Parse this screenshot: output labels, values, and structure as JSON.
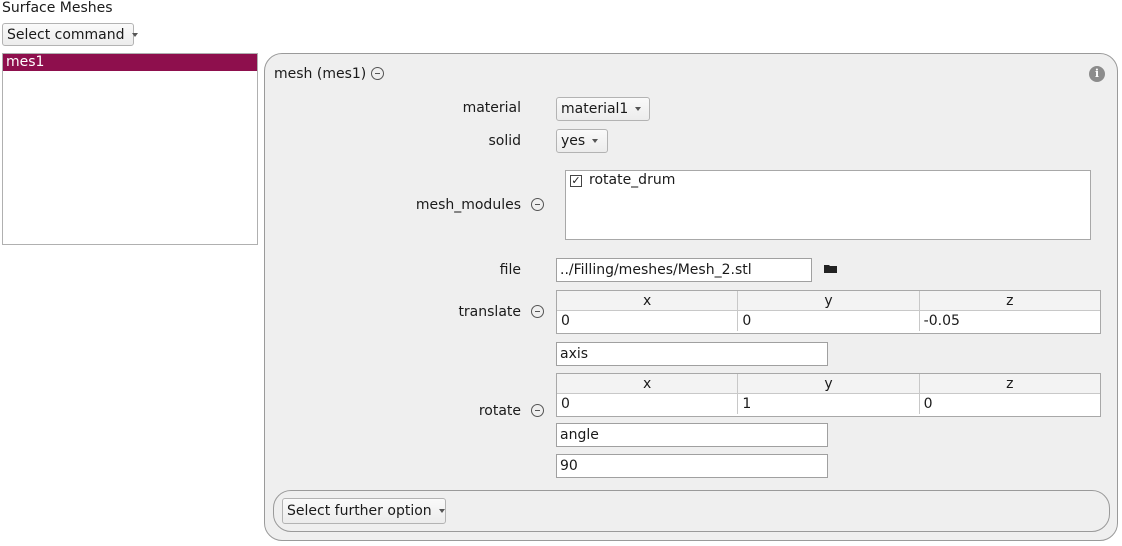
{
  "header": {
    "title": "Surface Meshes",
    "command_select": "Select command"
  },
  "mesh_list": {
    "items": [
      {
        "label": "mes1",
        "selected": true
      }
    ]
  },
  "panel": {
    "title": "mesh (mes1)",
    "info_icon": "info-icon",
    "material": {
      "label": "material",
      "value": "material1"
    },
    "solid": {
      "label": "solid",
      "value": "yes"
    },
    "mesh_modules": {
      "label": "mesh_modules",
      "items": [
        {
          "label": "rotate_drum",
          "checked": true
        }
      ]
    },
    "file": {
      "label": "file",
      "value": "../Filling/meshes/Mesh_2.stl",
      "icon": "folder-icon"
    },
    "translate": {
      "label": "translate",
      "headers": [
        "x",
        "y",
        "z"
      ],
      "values": [
        "0",
        "0",
        "-0.05"
      ]
    },
    "rotate": {
      "label": "rotate",
      "axis_field": "axis",
      "headers": [
        "x",
        "y",
        "z"
      ],
      "values": [
        "0",
        "1",
        "0"
      ],
      "angle_field": "angle",
      "angle_value": "90"
    },
    "further_option": "Select further option"
  },
  "colors": {
    "selection": "#8e0f4d",
    "panel_bg": "#efefef"
  }
}
